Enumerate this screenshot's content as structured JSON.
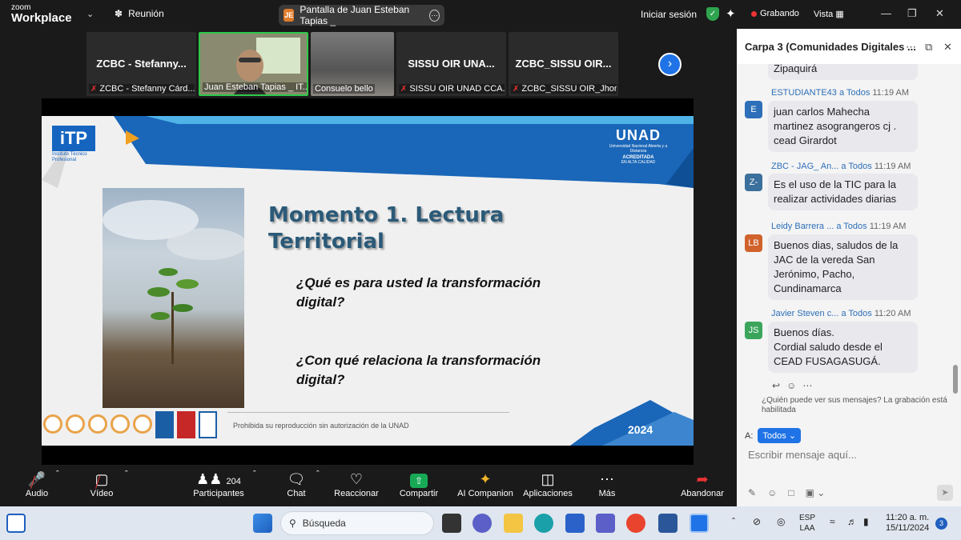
{
  "app": {
    "brand_top": "zoom",
    "brand_bottom": "Workplace",
    "meeting_label": "Reunión",
    "share_initials": "JE",
    "share_title": "Pantalla de Juan Esteban Tapias _",
    "signin": "Iniciar sesión",
    "recording": "Grabando",
    "view": "Vista"
  },
  "thumbnails": [
    {
      "name": "ZCBC - Stefanny...",
      "label": "ZCBC - Stefanny Cárd...",
      "muted": true
    },
    {
      "name": "",
      "label": "Juan Esteban Tapias _ IT...",
      "muted": false,
      "active": true
    },
    {
      "name": "",
      "label": "Consuelo bello",
      "muted": false
    },
    {
      "name": "SISSU OIR UNA...",
      "label": "SISSU OIR UNAD CCA...",
      "muted": true
    },
    {
      "name": "ZCBC_SISSU OIR...",
      "label": "ZCBC_SISSU OIR_Jhon...",
      "muted": true
    }
  ],
  "slide": {
    "itp_logo": "iTP",
    "itp_sub": "Instituto Técnico Profesional",
    "unad_logo": "UNAD",
    "unad_sub": "Universidad Nacional Abierta y a Distancia",
    "unad_acr": "ACREDITADA",
    "unad_acr_sub": "EN ALTA CALIDAD",
    "title_line1": "Momento 1. Lectura",
    "title_line2": "Territorial",
    "q1_line1": "¿Qué es para usted la transformación",
    "q1_line2": "digital?",
    "q2_line1": "¿Con qué relaciona la transformación",
    "q2_line2": "digital?",
    "footer": "Prohibida su reproducción sin autorización de la UNAD",
    "year": "2024"
  },
  "chat": {
    "title": "Carpa 3 (Comunidades Digitales ...",
    "messages": [
      {
        "text": "Zipaquirá"
      },
      {
        "sender": "ESTUDIANTE43",
        "to": "a Todos",
        "time": "11:19 AM",
        "initials": "E",
        "color": "#2d6fb8",
        "text": "juan carlos Mahecha martinez    asograngeros cj . cead Girardot"
      },
      {
        "sender": "ZBC - JAG_ An...",
        "to": "a Todos",
        "time": "11:19 AM",
        "initials": "Z-",
        "color": "#3b6f9c",
        "text": "Es el uso de la TIC para la realizar actividades diarias"
      },
      {
        "sender": "Leidy Barrera ...",
        "to": "a Todos",
        "time": "11:19 AM",
        "initials": "LB",
        "color": "#d0622c",
        "text": "Buenos dias, saludos de la JAC de la vereda San Jerónimo, Pacho, Cundinamarca"
      },
      {
        "sender": "Javier Steven c...",
        "to": "a Todos",
        "time": "11:20 AM",
        "initials": "JS",
        "color": "#3ba55c",
        "text_1": "Buenos días.",
        "text_2": "Cordial saludo desde el CEAD FUSAGASUGÁ."
      }
    ],
    "notice": "¿Quién puede ver sus mensajes? La grabación está habilitada",
    "to_label": "A:",
    "to_value": "Todos",
    "placeholder": "Escribir mensaje aquí..."
  },
  "toolbar": {
    "audio": "Audio",
    "video": "Vídeo",
    "participants": "Participantes",
    "participants_count": "204",
    "chat": "Chat",
    "react": "Reaccionar",
    "share": "Compartir",
    "ai": "AI Companion",
    "apps": "Aplicaciones",
    "more": "Más",
    "leave": "Abandonar"
  },
  "taskbar": {
    "search": "Búsqueda",
    "lang_1": "ESP",
    "lang_2": "LAA",
    "time": "11:20 a. m.",
    "date": "15/11/2024",
    "badge": "3"
  },
  "colors": {
    "accent": "#1f73e6",
    "green": "#2ec94a",
    "record": "#e33333",
    "slide_blue": "#1a66b8"
  }
}
